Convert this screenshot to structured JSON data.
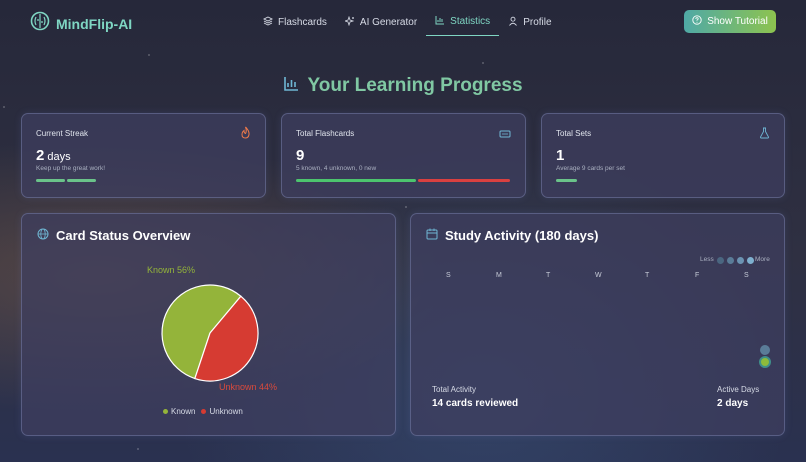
{
  "brand": {
    "name": "MindFlip-AI"
  },
  "nav": {
    "links": [
      {
        "label": "Flashcards",
        "icon": "layers-icon"
      },
      {
        "label": "AI Generator",
        "icon": "sparkles-icon"
      },
      {
        "label": "Statistics",
        "icon": "bar-chart-icon",
        "active": true
      },
      {
        "label": "Profile",
        "icon": "user-icon"
      }
    ],
    "tutorial_label": "Show Tutorial"
  },
  "page": {
    "title": "Your Learning Progress"
  },
  "stats": {
    "streak": {
      "label": "Current Streak",
      "value": "2",
      "unit": "days",
      "sub": "Keep up the great work!",
      "icon": "flame-icon"
    },
    "flashcards": {
      "label": "Total Flashcards",
      "value": "9",
      "sub": "5 known, 4 unknown, 0 new",
      "known_fraction": 0.56,
      "icon": "cards-icon"
    },
    "sets": {
      "label": "Total Sets",
      "value": "1",
      "sub": "Average 9 cards per set",
      "icon": "flask-icon"
    }
  },
  "card_status": {
    "title": "Card Status Overview",
    "icon": "globe-icon",
    "known_label": "Known 56%",
    "unknown_label": "Unknown 44%",
    "legend_known": "Known",
    "legend_unknown": "Unknown"
  },
  "chart_data": {
    "type": "pie",
    "categories": [
      "Known",
      "Unknown"
    ],
    "values": [
      56,
      44
    ],
    "colors": [
      "#94b43a",
      "#d63b32"
    ]
  },
  "activity": {
    "title": "Study Activity (180 days)",
    "icon": "calendar-icon",
    "days": [
      "S",
      "M",
      "T",
      "W",
      "T",
      "F",
      "S"
    ],
    "less": "Less",
    "more": "More",
    "total_label": "Total Activity",
    "total_value": "14 cards reviewed",
    "active_label": "Active Days",
    "active_value": "2 days"
  },
  "colors": {
    "accent": "#7fd6c3",
    "known": "#94b43a",
    "unknown": "#d63b32",
    "green": "#4cc46e",
    "red": "#d94040"
  }
}
